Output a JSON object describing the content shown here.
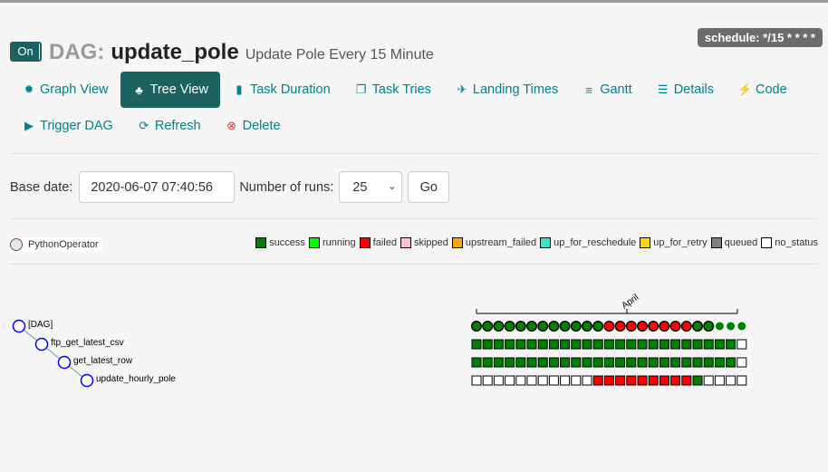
{
  "header": {
    "toggle_label": "On",
    "dag_prefix": "DAG:",
    "dag_id": "update_pole",
    "description": "Update Pole Every 15 Minute",
    "schedule": "schedule: */15 * * * *"
  },
  "nav": {
    "row1": [
      {
        "label": "Graph View",
        "icon": "sun-icon",
        "glyph": "✹"
      },
      {
        "label": "Tree View",
        "icon": "tree-icon",
        "glyph": "♣",
        "active": true
      },
      {
        "label": "Task Duration",
        "icon": "bar-chart-icon",
        "glyph": "▮"
      },
      {
        "label": "Task Tries",
        "icon": "copy-icon",
        "glyph": "❐"
      },
      {
        "label": "Landing Times",
        "icon": "plane-icon",
        "glyph": "✈"
      },
      {
        "label": "Gantt",
        "icon": "gantt-icon",
        "glyph": "≡"
      },
      {
        "label": "Details",
        "icon": "list-icon",
        "glyph": "☰"
      },
      {
        "label": "Code",
        "icon": "flash-icon",
        "glyph": "⚡"
      }
    ],
    "row2": [
      {
        "label": "Trigger DAG",
        "icon": "play-icon",
        "glyph": "▶"
      },
      {
        "label": "Refresh",
        "icon": "refresh-icon",
        "glyph": "⟳"
      },
      {
        "label": "Delete",
        "icon": "remove-icon",
        "glyph": "⊗"
      }
    ]
  },
  "form": {
    "base_date_label": "Base date:",
    "base_date_value": "2020-06-07 07:40:56",
    "runs_label": "Number of runs:",
    "runs_value": "25",
    "go_label": "Go"
  },
  "legend": {
    "operator": {
      "label": "PythonOperator",
      "color": "#f0e4e0"
    },
    "states": [
      {
        "label": "success",
        "color": "#008000"
      },
      {
        "label": "running",
        "color": "#00ff00"
      },
      {
        "label": "failed",
        "color": "#ff0000"
      },
      {
        "label": "skipped",
        "color": "#ffc0cb"
      },
      {
        "label": "upstream_failed",
        "color": "#ffa500"
      },
      {
        "label": "up_for_reschedule",
        "color": "#40e0d0"
      },
      {
        "label": "up_for_retry",
        "color": "#ffd700"
      },
      {
        "label": "queued",
        "color": "#808080"
      },
      {
        "label": "no_status",
        "color": "#ffffff"
      }
    ]
  },
  "tree": {
    "axis_label": "April",
    "nodes": [
      {
        "label": "[DAG]",
        "depth": 0
      },
      {
        "label": "ftp_get_latest_csv",
        "depth": 1
      },
      {
        "label": "get_latest_row",
        "depth": 2
      },
      {
        "label": "update_hourly_pole",
        "depth": 3
      }
    ],
    "dag_runs": [
      "success",
      "success",
      "success",
      "success",
      "success",
      "success",
      "success",
      "success",
      "success",
      "success",
      "success",
      "success",
      "failed",
      "failed",
      "failed",
      "failed",
      "failed",
      "failed",
      "failed",
      "failed",
      "success",
      "success",
      "success",
      "success",
      "success"
    ],
    "task_rows": [
      [
        "success",
        "success",
        "success",
        "success",
        "success",
        "success",
        "success",
        "success",
        "success",
        "success",
        "success",
        "success",
        "success",
        "success",
        "success",
        "success",
        "success",
        "success",
        "success",
        "success",
        "success",
        "success",
        "success",
        "success",
        "no_status"
      ],
      [
        "success",
        "success",
        "success",
        "success",
        "success",
        "success",
        "success",
        "success",
        "success",
        "success",
        "success",
        "success",
        "success",
        "success",
        "success",
        "success",
        "success",
        "success",
        "success",
        "success",
        "success",
        "success",
        "success",
        "success",
        "no_status"
      ],
      [
        "no_status",
        "no_status",
        "no_status",
        "no_status",
        "no_status",
        "no_status",
        "no_status",
        "no_status",
        "no_status",
        "no_status",
        "no_status",
        "failed",
        "failed",
        "failed",
        "failed",
        "failed",
        "failed",
        "failed",
        "failed",
        "failed",
        "success",
        "no_status",
        "no_status",
        "no_status",
        "no_status"
      ]
    ],
    "dag_run_colors": {
      "success": "#008000",
      "failed": "#ff0000"
    },
    "task_colors": {
      "success": "#008000",
      "failed": "#ff0000",
      "no_status": "#ffffff"
    }
  }
}
